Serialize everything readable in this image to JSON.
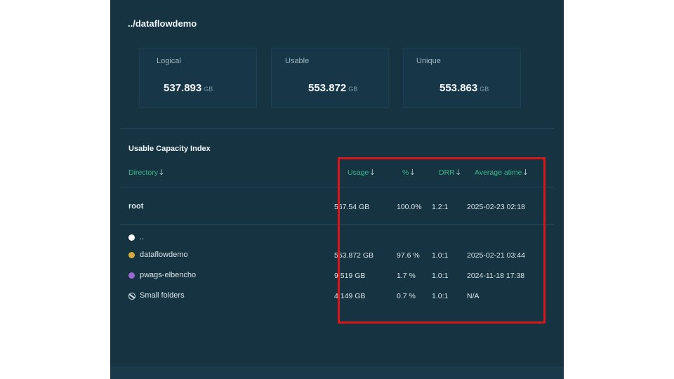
{
  "header": {
    "path": "../dataflowdemo"
  },
  "stats": [
    {
      "label": "Logical",
      "value": "537.893",
      "unit": "GB"
    },
    {
      "label": "Usable",
      "value": "553.872",
      "unit": "GB"
    },
    {
      "label": "Unique",
      "value": "553.863",
      "unit": "GB"
    }
  ],
  "capacity": {
    "title": "Usable Capacity Index",
    "columns": {
      "directory": "Directory",
      "usage": "Usage",
      "percent": "%",
      "drr": "DRR",
      "atime": "Average atime"
    },
    "root": {
      "name": "root",
      "usage": "567.54 GB",
      "percent": "100.0%",
      "drr": "1.2:1",
      "atime": "2025-02-23 02:18"
    },
    "parent": {
      "name": ".."
    },
    "rows": [
      {
        "name": "dataflowdemo",
        "color": "#d9a93c",
        "usage": "553.872 GB",
        "percent": "97.6 %",
        "drr": "1.0:1",
        "atime": "2025-02-21 03:44"
      },
      {
        "name": "pwags-elbencho",
        "color": "#9b6ad6",
        "usage": "9.519 GB",
        "percent": "1.7 %",
        "drr": "1.0:1",
        "atime": "2024-11-18 17:38"
      },
      {
        "name": "Small folders",
        "color": "#dbe6ec",
        "usage": "4.149 GB",
        "percent": "0.7 %",
        "drr": "1.0:1",
        "atime": "N/A"
      }
    ]
  },
  "colors": {
    "panel_bg": "#163342",
    "accent": "#37b88a",
    "highlight": "#d8171b"
  },
  "icons": {
    "sort": "arrow-down-icon",
    "parent": "white-dot-icon",
    "small_folders": "slashed-circle-icon"
  }
}
